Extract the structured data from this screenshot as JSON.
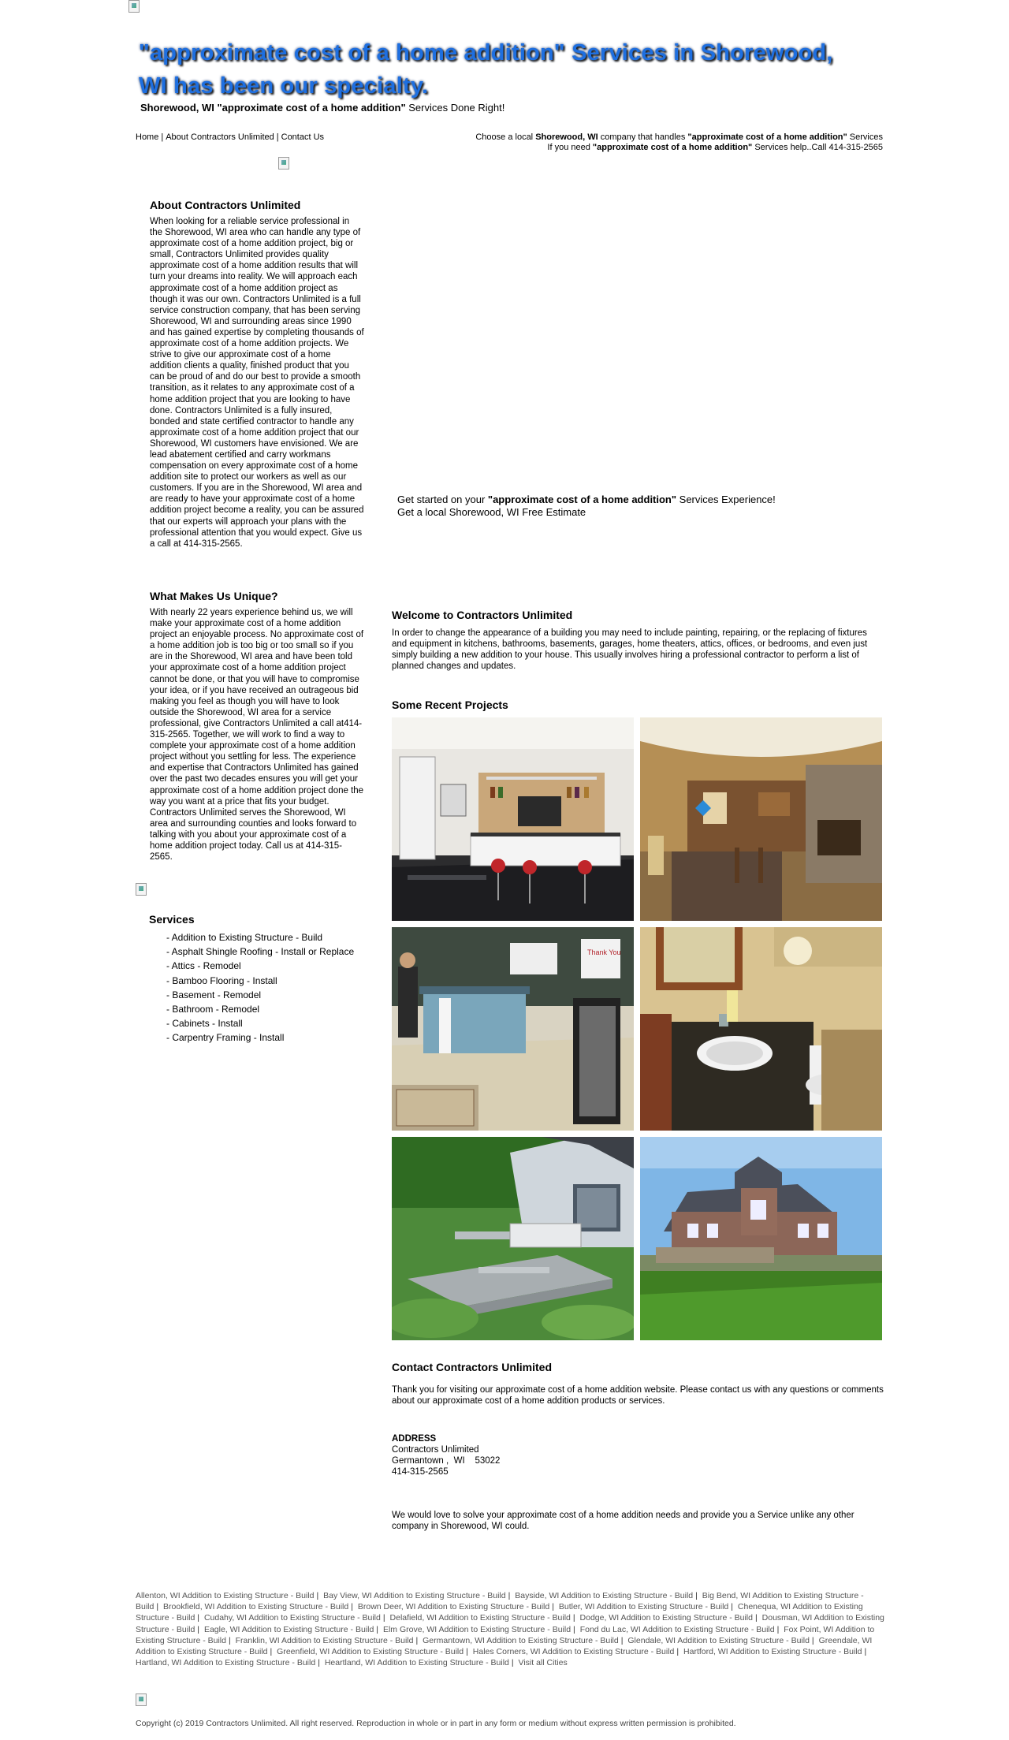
{
  "hero": {
    "title": "\"approximate cost of a home addition\" Services in Shorewood, WI has been our specialty.",
    "sub_bold": "Shorewood, WI \"approximate cost of a home addition\"",
    "sub_rest": " Services Done Right!"
  },
  "topnav": {
    "items": [
      "Home",
      "About Contractors Unlimited",
      "Contact Us"
    ]
  },
  "topright": {
    "line1_a": "Choose a local ",
    "line1_b": "Shorewood, WI",
    "line1_c": " company that handles ",
    "line1_d": "\"approximate cost of a home addition\"",
    "line1_e": " Services",
    "line2_a": "If you need ",
    "line2_b": "\"approximate cost of a home addition\"",
    "line2_c": " Services help..Call 414-315-2565"
  },
  "about": {
    "heading": "About Contractors Unlimited",
    "body": "When looking for a reliable service professional in the Shorewood, WI area who can handle any type of approximate cost of a home addition project, big or small, Contractors Unlimited provides quality approximate cost of a home addition results that will turn your dreams into reality. We will approach each approximate cost of a home addition project as though it was our own. Contractors Unlimited is a full service construction company, that has been serving Shorewood, WI and surrounding areas since 1990 and has gained expertise by completing thousands of approximate cost of a home addition projects. We strive to give our approximate cost of a home addition clients a quality, finished product that you can be proud of and do our best to provide a smooth transition, as it relates to any approximate cost of a home addition project that you are looking to have done. Contractors Unlimited is a fully insured, bonded and state certified contractor to handle any approximate cost of a home addition project that our Shorewood, WI customers have envisioned. We are lead abatement certified and carry workmans compensation on every approximate cost of a home addition site to protect our workers as well as our customers. If you are in the Shorewood, WI area and are ready to have your approximate cost of a home addition project become a reality, you can be assured that our experts will approach your plans with the professional attention that you would expect. Give us a call at 414-315-2565."
  },
  "unique": {
    "heading": "What Makes Us Unique?",
    "body": "With nearly 22 years experience behind us, we will make your approximate cost of a home addition project an enjoyable process. No approximate cost of a home addition job is too big or too small so if you are in the Shorewood, WI area and have been told your approximate cost of a home addition project cannot be done, or that you will have to compromise your idea, or if you have received an outrageous bid making you feel as though you will have to look outside the Shorewood, WI area for a service professional, give Contractors Unlimited a call at414-315-2565. Together, we will work to find a way to complete your approximate cost of a home addition project without you settling for less. The experience and expertise that Contractors Unlimited has gained over the past two decades ensures you will get your approximate cost of a home addition project done the way you want at a price that fits your budget. Contractors Unlimited serves the Shorewood, WI area and surrounding counties and looks forward to talking with you about your approximate cost of a home addition project today. Call us at 414-315-2565."
  },
  "services": {
    "heading": "Services",
    "items": [
      "- Addition to Existing Structure - Build",
      "- Asphalt Shingle Roofing - Install or Replace",
      "- Attics - Remodel",
      "- Bamboo Flooring - Install",
      "- Basement - Remodel",
      "- Bathroom - Remodel",
      "- Cabinets - Install",
      "- Carpentry Framing - Install"
    ]
  },
  "get_started": {
    "line1_a": "Get started on your ",
    "line1_b": "\"approximate cost of a home addition\"",
    "line1_c": " Services Experience!",
    "line2": "Get a local Shorewood, WI Free Estimate"
  },
  "welcome": {
    "heading": "Welcome to Contractors Unlimited",
    "body": "In order to change the appearance of a building you may need to include painting, repairing, or the replacing of fixtures and equipment in kitchens, bathrooms, basements, garages, home theaters, attics, offices, or bedrooms, and even just simply building a new addition to your house. This usually involves hiring a professional contractor to perform a list of planned changes and updates."
  },
  "projects": {
    "heading": "Some Recent Projects",
    "photo_sign_text": "Thank You"
  },
  "contact": {
    "heading": "Contact Contractors Unlimited",
    "intro": "Thank you for visiting our approximate cost of a home addition website. Please contact us with any questions or comments about our approximate cost of a home addition products or services.",
    "address_label": "ADDRESS",
    "company": "Contractors Unlimited",
    "city_line": "Germantown ,  WI    53022",
    "phone": "414-315-2565",
    "closing": "We would love to solve your approximate cost of a home addition needs and provide you a Service unlike any other company in Shorewood, WI could."
  },
  "cities": [
    "Allenton, WI Addition to Existing Structure - Build",
    "Bay View, WI Addition to Existing Structure - Build",
    "Bayside, WI Addition to Existing Structure - Build",
    "Big Bend, WI Addition to Existing Structure - Build",
    "Brookfield, WI Addition to Existing Structure - Build",
    "Brown Deer, WI Addition to Existing Structure - Build",
    "Butler, WI Addition to Existing Structure - Build",
    "Chenequa, WI Addition to Existing Structure - Build",
    "Cudahy, WI Addition to Existing Structure - Build",
    "Delafield, WI Addition to Existing Structure - Build",
    "Dodge, WI Addition to Existing Structure - Build",
    "Dousman, WI Addition to Existing Structure - Build",
    "Eagle, WI Addition to Existing Structure - Build",
    "Elm Grove, WI Addition to Existing Structure - Build",
    "Fond du Lac, WI Addition to Existing Structure - Build",
    "Fox Point, WI Addition to Existing Structure - Build",
    "Franklin, WI Addition to Existing Structure - Build",
    "Germantown, WI Addition to Existing Structure - Build",
    "Glendale, WI Addition to Existing Structure - Build",
    "Greendale, WI Addition to Existing Structure - Build",
    "Greenfield, WI Addition to Existing Structure - Build",
    "Hales Corners, WI Addition to Existing Structure - Build",
    "Hartford, WI Addition to Existing Structure - Build",
    "Hartland, WI Addition to Existing Structure - Build",
    "Heartland, WI Addition to Existing Structure - Build",
    "Visit all Cities"
  ],
  "copyright": "Copyright (c) 2019 Contractors Unlimited. All right reserved. Reproduction in whole or in part in any form or medium without express written permission is prohibited.",
  "colors": {
    "hero_title": "#1e6fe0",
    "link_gray": "#555555"
  }
}
